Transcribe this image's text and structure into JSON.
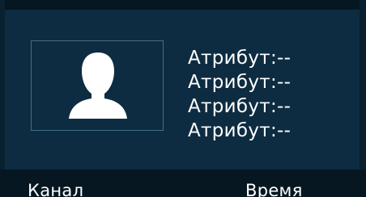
{
  "panel": {
    "attributes": [
      "Атрибут:--",
      "Атрибут:--",
      "Атрибут:--",
      "Атрибут:--"
    ]
  },
  "footer": {
    "channel_label": "Канал",
    "time_label": "Время"
  },
  "icons": {
    "avatar": "person-silhouette-icon"
  },
  "colors": {
    "panel_background": "#0e2c41",
    "dark_strip": "#061722",
    "photo_border": "#466d86",
    "text": "#ffffff"
  }
}
